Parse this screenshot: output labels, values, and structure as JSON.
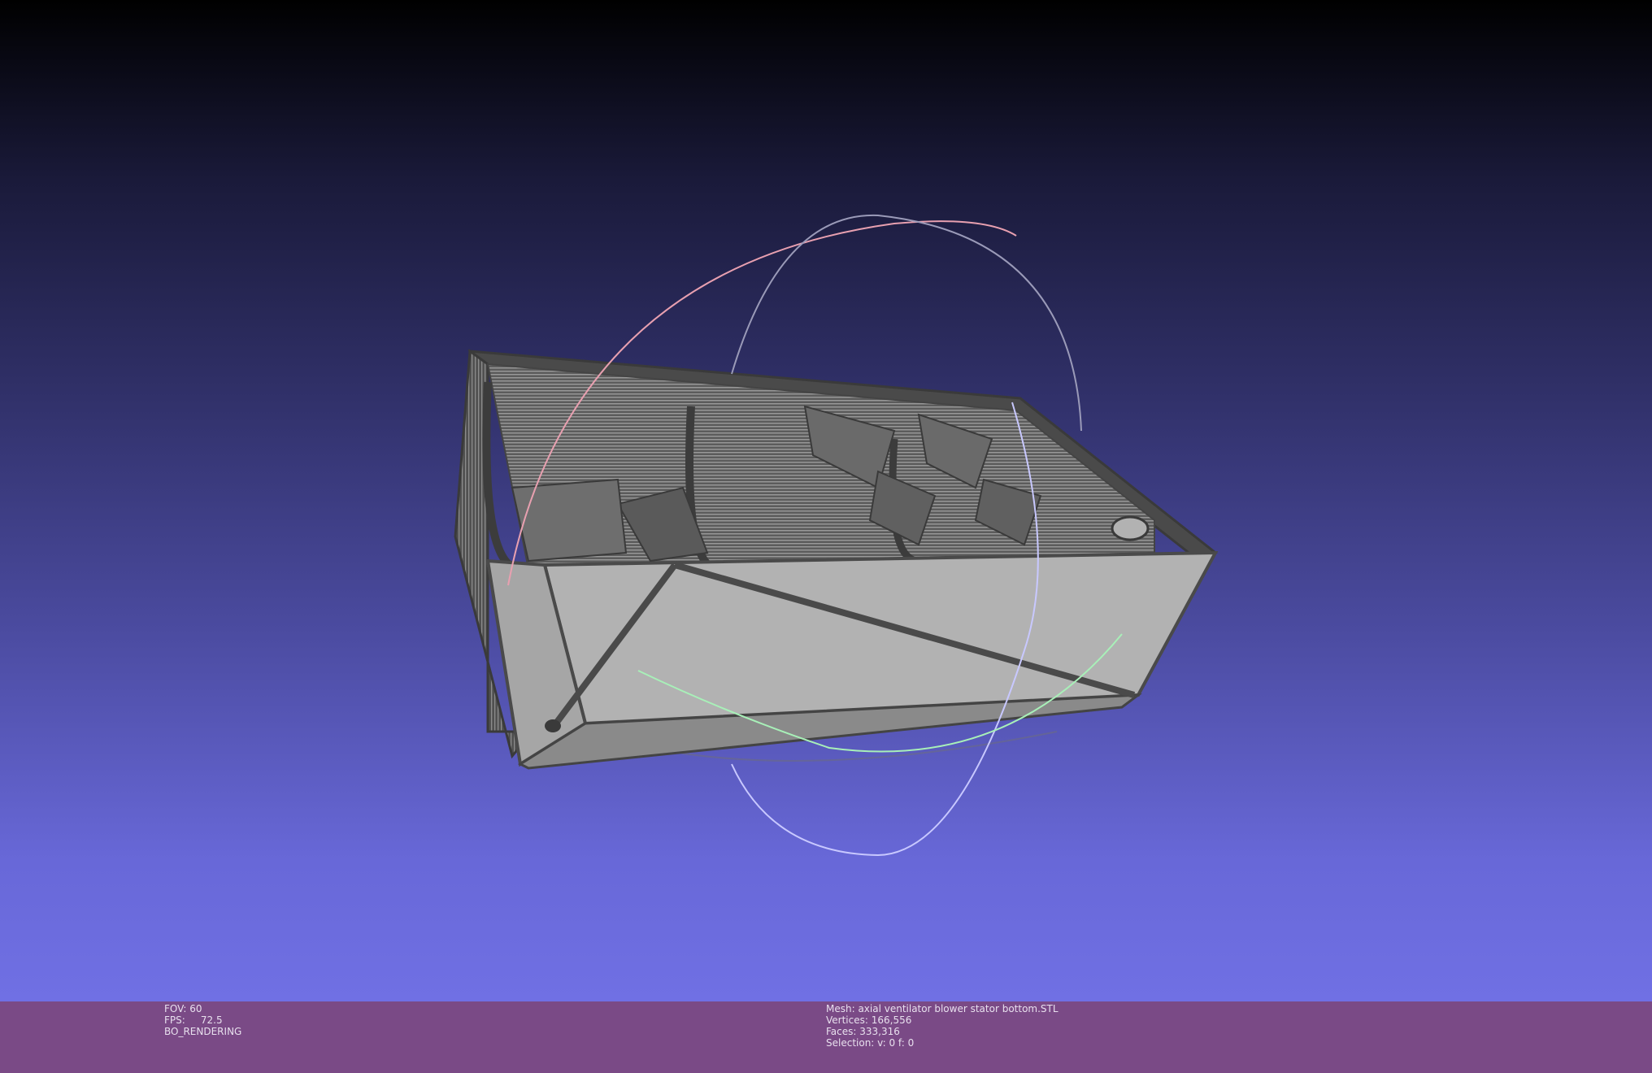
{
  "info_left": {
    "fov": "FOV: 60",
    "fps": "FPS:     72.5",
    "mode": "BO_RENDERING"
  },
  "info_right": {
    "mesh": "Mesh: axial ventilator blower stator bottom.STL",
    "vertices": "Vertices: 166,556",
    "faces": "Faces: 333,316",
    "selection": "Selection: v: 0 f: 0"
  },
  "colors": {
    "infobar_bg": "#7a4a86",
    "mesh_light": "#b2b2b2",
    "mesh_dark": "#4a4a4a",
    "trackball_red": "#e8a0b0",
    "trackball_green": "#a8f0b8",
    "trackball_blue": "#c8c8ff"
  }
}
